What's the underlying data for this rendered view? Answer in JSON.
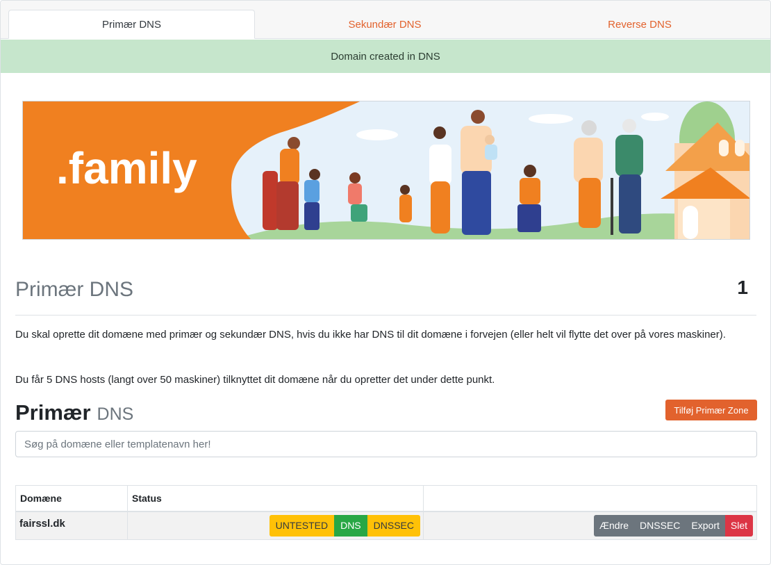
{
  "tabs": [
    {
      "label": "Primær DNS",
      "active": true
    },
    {
      "label": "Sekundær DNS",
      "active": false
    },
    {
      "label": "Reverse DNS",
      "active": false
    }
  ],
  "alert": {
    "text": "Domain created in DNS",
    "color": "#c6e6cc"
  },
  "banner": {
    "logo_text": ".family",
    "accent": "#f08020"
  },
  "section": {
    "title": "Primær DNS",
    "count": "1",
    "paragraph1": "Du skal oprette dit domæne med primær og sekundær DNS, hvis du ikke har DNS til dit domæne i forvejen (eller helt vil flytte det over på vores maskiner).",
    "paragraph2": "Du får 5 DNS hosts (langt over 50 maskiner) tilknyttet dit domæne når du opretter det under dette punkt."
  },
  "zone": {
    "heading_main": "Primær",
    "heading_muted": "DNS",
    "add_button": "Tilføj Primær Zone",
    "search_placeholder": "Søg på domæne eller templatenavn her!"
  },
  "table": {
    "headers": [
      "Domæne",
      "Status",
      ""
    ],
    "rows": [
      {
        "domain": "fairssl.dk",
        "badges": [
          {
            "label": "UNTESTED",
            "color": "#ffc107"
          },
          {
            "label": "DNS",
            "color": "#28a745"
          },
          {
            "label": "DNSSEC",
            "color": "#ffc107"
          }
        ],
        "actions": [
          {
            "label": "Ændre",
            "color": "#6c757d"
          },
          {
            "label": "DNSSEC",
            "color": "#6c757d"
          },
          {
            "label": "Export",
            "color": "#6c757d"
          },
          {
            "label": "Slet",
            "color": "#dc3545"
          }
        ]
      }
    ]
  },
  "colors": {
    "accent": "#e2622d",
    "success": "#28a745",
    "warning": "#ffc107",
    "danger": "#dc3545"
  }
}
